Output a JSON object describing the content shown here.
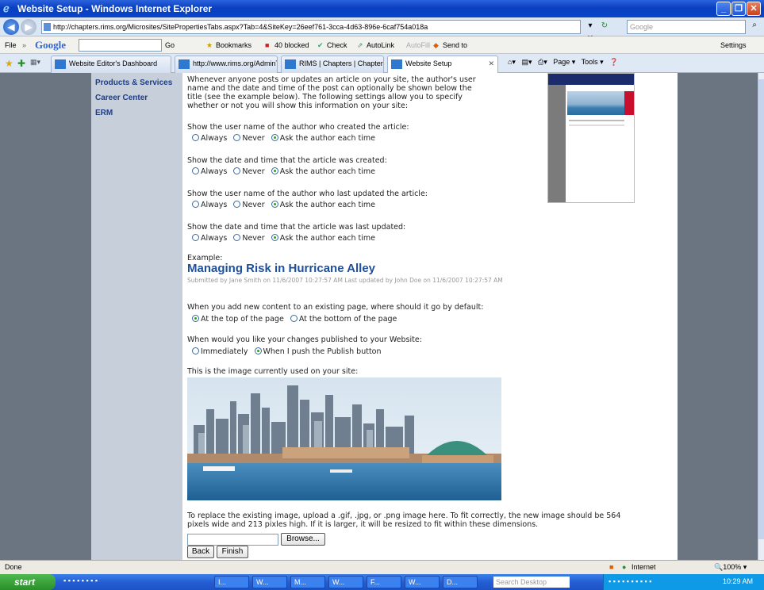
{
  "window": {
    "title": "Website Setup - Windows Internet Explorer"
  },
  "address": {
    "url": "http://chapters.rims.org/Microsites/SitePropertiesTabs.aspx?Tab=4&SiteKey=26eef761-3cca-4d63-896e-6caf754a018a",
    "search_placeholder": "Google"
  },
  "google_toolbar": {
    "file_menu": "File",
    "logo": "Google",
    "go_label": "Go",
    "bookmarks": "Bookmarks",
    "blocked": "40 blocked",
    "check": "Check",
    "autolink": "AutoLink",
    "autofill": "AutoFill",
    "sendto": "Send to",
    "settings": "Settings"
  },
  "tabs": [
    {
      "label": "Website Editor's Dashboard"
    },
    {
      "label": "http://www.rims.org/AdminT..."
    },
    {
      "label": "RIMS | Chapters | Chapter ..."
    },
    {
      "label": "Website Setup"
    }
  ],
  "tab_tools": {
    "page": "Page",
    "tools": "Tools"
  },
  "leftnav": {
    "items": [
      {
        "label": "Products & Services"
      },
      {
        "label": "Career Center"
      },
      {
        "label": "ERM"
      }
    ]
  },
  "main": {
    "intro": [
      "Whenever anyone posts or updates an article on your site, the author's user",
      "name and the date and time of the post can optionally be shown below the",
      "title (see the example below). The following settings allow you to specify",
      "whether or not you will show this information on your site:"
    ],
    "questions": [
      {
        "label": "Show the user name of the author who created the article:",
        "options": [
          "Always",
          "Never",
          "Ask the author each time"
        ],
        "selected": 2
      },
      {
        "label": "Show the date and time that the article was created:",
        "options": [
          "Always",
          "Never",
          "Ask the author each time"
        ],
        "selected": 2
      },
      {
        "label": "Show the user name of the author who last updated the article:",
        "options": [
          "Always",
          "Never",
          "Ask the author each time"
        ],
        "selected": 2
      },
      {
        "label": "Show the date and time that the article was last updated:",
        "options": [
          "Always",
          "Never",
          "Ask the author each time"
        ],
        "selected": 2
      }
    ],
    "example_label": "Example:",
    "example_title": "Managing Risk in Hurricane Alley",
    "example_meta": "Submitted by Jane Smith on 11/6/2007 10:27:57 AM   Last updated by John Doe on 11/6/2007 10:27:57 AM",
    "placement": {
      "label": "When you add new content to an existing page, where should it go by default:",
      "options": [
        "At the top of the page",
        "At the bottom of the page"
      ],
      "selected": 0
    },
    "publish": {
      "label": "When would you like your changes published to your Website:",
      "options": [
        "Immediately",
        "When I push the Publish button"
      ],
      "selected": 1
    },
    "image_label": "This is the image currently used on your site:",
    "replace_text": [
      "To replace the existing image, upload a .gif, .jpg, or .png image here. To fit correctly, the new image should be 564",
      "pixels wide and 213 pixles high. If it is larger, it will be resized to fit within these dimensions."
    ],
    "browse_label": "Browse...",
    "back_label": "Back",
    "finish_label": "Finish"
  },
  "status": {
    "text": "Done",
    "zone": "Internet",
    "zoom": "100%"
  },
  "taskbar": {
    "start": "start",
    "items": [
      "I...",
      "W...",
      "M...",
      "W...",
      "F...",
      "W...",
      "D..."
    ],
    "search_placeholder": "Search Desktop",
    "clock": "10:29 AM"
  }
}
